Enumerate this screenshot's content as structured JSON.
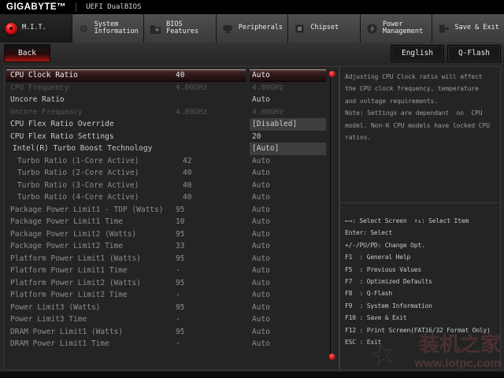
{
  "titlebar": {
    "brand": "GIGABYTE™",
    "product": "UEFI DualBIOS"
  },
  "tabs": [
    {
      "label": "M.I.T.",
      "icon": "record-icon",
      "active": true
    },
    {
      "label": "System Information",
      "icon": "gear-icon",
      "active": false
    },
    {
      "label": "BIOS Features",
      "icon": "folder-plus-icon",
      "active": false
    },
    {
      "label": "Peripherals",
      "icon": "monitor-icon",
      "active": false
    },
    {
      "label": "Chipset",
      "icon": "chip-icon",
      "active": false
    },
    {
      "label": "Power Management",
      "icon": "power-bolt-icon",
      "active": false
    },
    {
      "label": "Save & Exit",
      "icon": "exit-door-icon",
      "active": false
    }
  ],
  "subbar": {
    "back_label": "Back",
    "language_label": "English",
    "qflash_label": "Q-Flash"
  },
  "settings": {
    "rows": [
      {
        "label": "CPU Clock Ratio",
        "current": "40",
        "option": "Auto",
        "state": "selected",
        "boxed": false,
        "indent": 0
      },
      {
        "label": "CPU Frequency",
        "current": "4.00GHz",
        "option": "4.00GHz",
        "state": "dim",
        "boxed": false,
        "indent": 0
      },
      {
        "label": "Uncore Ratio",
        "current": "",
        "option": "Auto",
        "state": "normal",
        "boxed": false,
        "indent": 0
      },
      {
        "label": "Uncore Frequency",
        "current": "4.00GHz",
        "option": "4.00GHz",
        "state": "dim",
        "boxed": false,
        "indent": 0
      },
      {
        "label": "CPU Flex Ratio Override",
        "current": "",
        "option": "[Disabled]",
        "state": "normal",
        "boxed": true,
        "indent": 0
      },
      {
        "label": "CPU Flex Ratio Settings",
        "current": "",
        "option": "20",
        "state": "normal",
        "boxed": false,
        "indent": 0
      },
      {
        "label": "Intel(R) Turbo Boost Technology",
        "current": "",
        "option": "[Auto]",
        "state": "normal",
        "boxed": true,
        "indent": 3
      },
      {
        "label": "Turbo Ratio (1-Core Active)",
        "current": "42",
        "option": "Auto",
        "state": "sub",
        "boxed": false,
        "indent": 9
      },
      {
        "label": "Turbo Ratio (2-Core Active)",
        "current": "40",
        "option": "Auto",
        "state": "sub",
        "boxed": false,
        "indent": 9
      },
      {
        "label": "Turbo Ratio (3-Core Active)",
        "current": "40",
        "option": "Auto",
        "state": "sub",
        "boxed": false,
        "indent": 9
      },
      {
        "label": "Turbo Ratio (4-Core Active)",
        "current": "40",
        "option": "Auto",
        "state": "sub",
        "boxed": false,
        "indent": 9
      },
      {
        "label": "Package Power Limit1 - TDP (Watts)",
        "current": "95",
        "option": "Auto",
        "state": "sub",
        "boxed": false,
        "indent": 0
      },
      {
        "label": "Package Power Limit1 Time",
        "current": "10",
        "option": "Auto",
        "state": "sub",
        "boxed": false,
        "indent": 0
      },
      {
        "label": "Package Power Limit2 (Watts)",
        "current": "95",
        "option": "Auto",
        "state": "sub",
        "boxed": false,
        "indent": 0
      },
      {
        "label": "Package Power Limit2 Time",
        "current": "33",
        "option": "Auto",
        "state": "sub",
        "boxed": false,
        "indent": 0
      },
      {
        "label": "Platform Power Limit1 (Watts)",
        "current": "95",
        "option": "Auto",
        "state": "sub",
        "boxed": false,
        "indent": 0
      },
      {
        "label": "Platform Power Limit1 Time",
        "current": "-",
        "option": "Auto",
        "state": "sub",
        "boxed": false,
        "indent": 0
      },
      {
        "label": "Platform Power Limit2 (Watts)",
        "current": "95",
        "option": "Auto",
        "state": "sub",
        "boxed": false,
        "indent": 0
      },
      {
        "label": "Platform Power Limit2 Time",
        "current": "-",
        "option": "Auto",
        "state": "sub",
        "boxed": false,
        "indent": 0
      },
      {
        "label": "Power Limit3 (Watts)",
        "current": "95",
        "option": "Auto",
        "state": "sub",
        "boxed": false,
        "indent": 0
      },
      {
        "label": "Power Limit3 Time",
        "current": "-",
        "option": "Auto",
        "state": "sub",
        "boxed": false,
        "indent": 0
      },
      {
        "label": "DRAM Power Limit1 (Watts)",
        "current": "95",
        "option": "Auto",
        "state": "sub",
        "boxed": false,
        "indent": 0
      },
      {
        "label": "DRAM Power Limit1 Time",
        "current": "-",
        "option": "Auto",
        "state": "sub",
        "boxed": false,
        "indent": 0
      }
    ]
  },
  "help": {
    "lines": [
      "Adjusting CPU Clock ratio will affect",
      "the CPU clock frequency, temperature",
      "and voltage requirements.",
      "Note: Settings are dependant  on  CPU",
      "model. Non-K CPU models have locked CPU",
      "ratios."
    ]
  },
  "legend": {
    "lines": [
      "←→: Select Screen  ↑↓: Select Item",
      "Enter: Select",
      "+/-/PU/PD: Change Opt.",
      "F1  : General Help",
      "F5  : Previous Values",
      "F7  : Optimized Defaults",
      "F8  : Q-Flash",
      "F9  : System Information",
      "F10 : Save & Exit",
      "F12 : Print Screen(FAT16/32 Format Only)",
      "ESC : Exit"
    ]
  },
  "watermark": {
    "text": "装机之家",
    "url": "www.lotpc.com"
  },
  "colors": {
    "accent_red": "#cc1212",
    "selected_row_highlight": "#2a1414",
    "value_box_bg": "#3e3e3e",
    "tab_inactive_bg": "#454545",
    "panel_bg": "#242424"
  }
}
